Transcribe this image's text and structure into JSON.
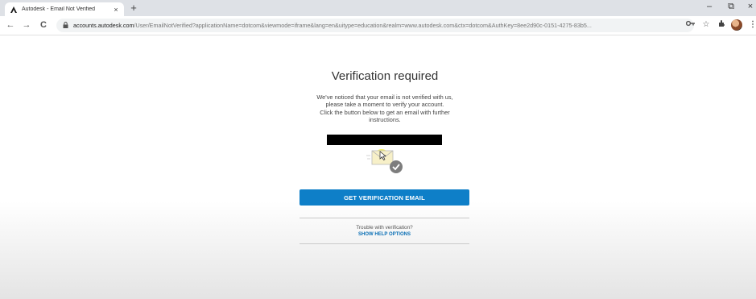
{
  "browser": {
    "tab_title": "Autodesk - Email Not Verified",
    "tab_close_glyph": "×",
    "new_tab_glyph": "+",
    "url_host": "accounts.autodesk.com",
    "url_rest": "/User/EmailNotVerified?applicationName=dotcom&viewmode=iframe&lang=en&uitype=education&realm=www.autodesk.com&ctx=dotcom&AuthKey=8ee2d90c-0151-4275-83b5...",
    "back_glyph": "←",
    "forward_glyph": "→",
    "reload_glyph": "C",
    "minimize_glyph": "–",
    "restore_glyph": "⧉",
    "close_glyph": "×",
    "icons": [
      "autodesk-logo-icon",
      "lock-icon",
      "key-icon",
      "star-icon",
      "extensions-icon",
      "profile-avatar-icon",
      "more-icon"
    ]
  },
  "page": {
    "heading": "Verification required",
    "body_lines": [
      "We've noticed that your email is not verified with us,",
      "please take a moment to verify your account.",
      "Click the button below to get an email with further",
      "instructions."
    ],
    "cta_label": "GET VERIFICATION EMAIL",
    "trouble_text": "Trouble with verification?",
    "help_link": "SHOW HELP OPTIONS"
  },
  "colors": {
    "cta": "#0e7fc8",
    "link": "#0a6fb5",
    "redaction": "#000000"
  }
}
